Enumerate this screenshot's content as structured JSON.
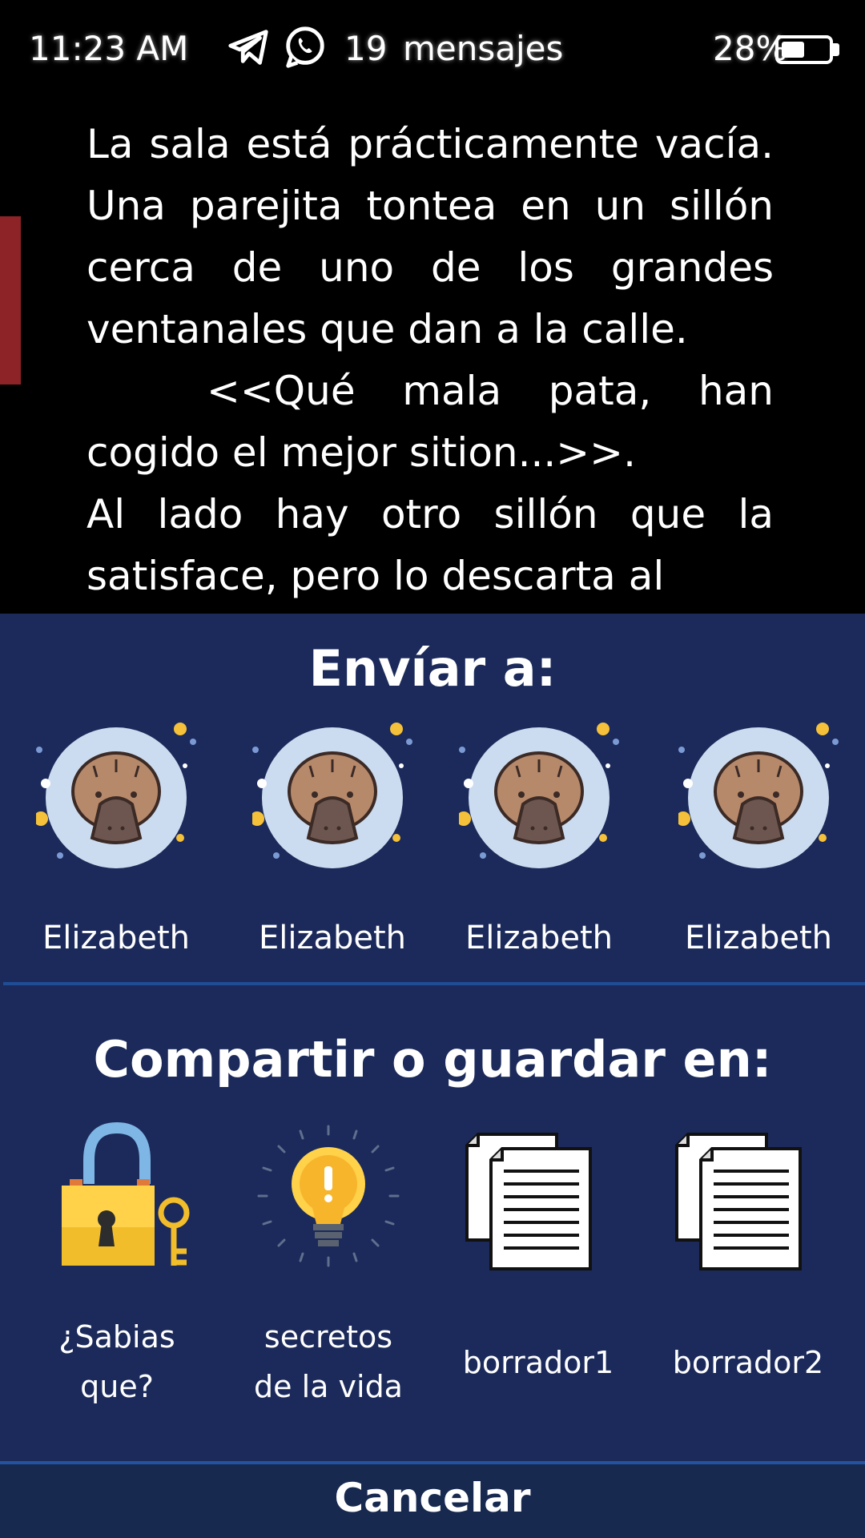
{
  "status_bar": {
    "time": "11:23 AM",
    "app_icons": [
      "telegram-icon",
      "whatsapp-icon"
    ],
    "message_count": "19",
    "message_label": "mensajes",
    "battery_percent": "28%",
    "battery_level": 0.28
  },
  "reader": {
    "paragraphs": [
      "La sala está prácticamente vacía. Una parejita tontea en un sillón cerca de uno de los grandes ventanales que dan a la calle.",
      "<<Qué mala pata, han cogido el mejor sition...>>.",
      "Al lado hay otro sillón que la satisface, pero lo descarta al"
    ],
    "accent_color": "#8d2327"
  },
  "share_sheet": {
    "send_title": "Envíar a:",
    "contacts": [
      {
        "name": "Elizabeth",
        "avatar": "platypus-avatar-icon"
      },
      {
        "name": "Elizabeth",
        "avatar": "platypus-avatar-icon"
      },
      {
        "name": "Elizabeth",
        "avatar": "platypus-avatar-icon"
      },
      {
        "name": "Elizabeth",
        "avatar": "platypus-avatar-icon"
      }
    ],
    "save_title": "Compartir o guardar en:",
    "targets": [
      {
        "label": "¿Sabias\nque?",
        "icon": "padlock-key-icon"
      },
      {
        "label": "secretos\nde la vida",
        "icon": "lightbulb-icon"
      },
      {
        "label": "borrador1",
        "icon": "documents-icon"
      },
      {
        "label": "borrador2",
        "icon": "documents-icon"
      }
    ],
    "cancel_label": "Cancelar",
    "background_color": "#1b2a5a",
    "divider_color": "#1f4d96"
  }
}
